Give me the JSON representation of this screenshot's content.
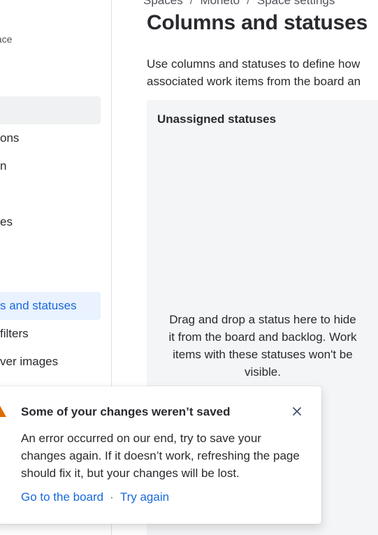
{
  "sidebar": {
    "subtitle": "pace",
    "items": [
      {
        "label": "",
        "state": "hovered"
      },
      {
        "label": "ons",
        "state": "normal"
      },
      {
        "label": "n",
        "state": "normal"
      },
      {
        "label": "es",
        "state": "normal"
      },
      {
        "label": "s and statuses",
        "state": "selected"
      },
      {
        "label": "filters",
        "state": "normal"
      },
      {
        "label": "ver images",
        "state": "normal"
      }
    ]
  },
  "breadcrumb": {
    "items": [
      "Spaces",
      "Moneto",
      "Space settings"
    ],
    "separator": "/"
  },
  "page": {
    "title": "Columns and statuses",
    "description_line1": "Use columns and statuses to define how",
    "description_line2": "associated work items from the board an"
  },
  "unassigned": {
    "title": "Unassigned statuses",
    "hint": "Drag and drop a status here to hide it from the board and backlog. Work items with these statuses won't be visible."
  },
  "flag": {
    "title": "Some of your changes weren’t saved",
    "body": "An error occurred on our end, try to save your changes again. If it doesn’t work, refreshing the page should fix it, but your changes will be lost.",
    "action_primary": "Go to the board",
    "separator": "·",
    "action_secondary": "Try again",
    "icon": "warning-icon"
  },
  "colors": {
    "accent": "#1868db",
    "selected_bg": "#e9f2fe",
    "hover_bg": "#f0f1f2",
    "panel_bg": "#f4f5f7",
    "warning": "#e06c00"
  }
}
